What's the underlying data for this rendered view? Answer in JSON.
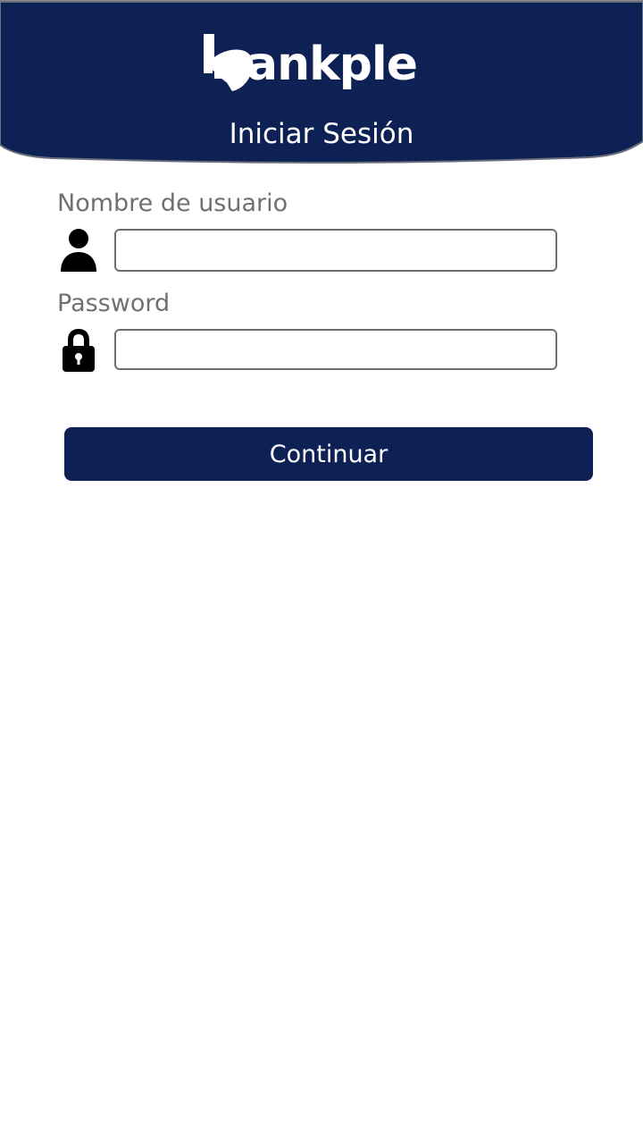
{
  "brand": {
    "name": "bankple",
    "logo_rest": "ankple",
    "color_primary": "#0d2155",
    "color_text_on_primary": "#ffffff"
  },
  "header": {
    "title": "Iniciar Sesión"
  },
  "form": {
    "username": {
      "label": "Nombre de usuario",
      "value": "",
      "icon": "person-icon"
    },
    "password": {
      "label": "Password",
      "value": "",
      "icon": "lock-icon"
    },
    "submit_label": "Continuar"
  }
}
